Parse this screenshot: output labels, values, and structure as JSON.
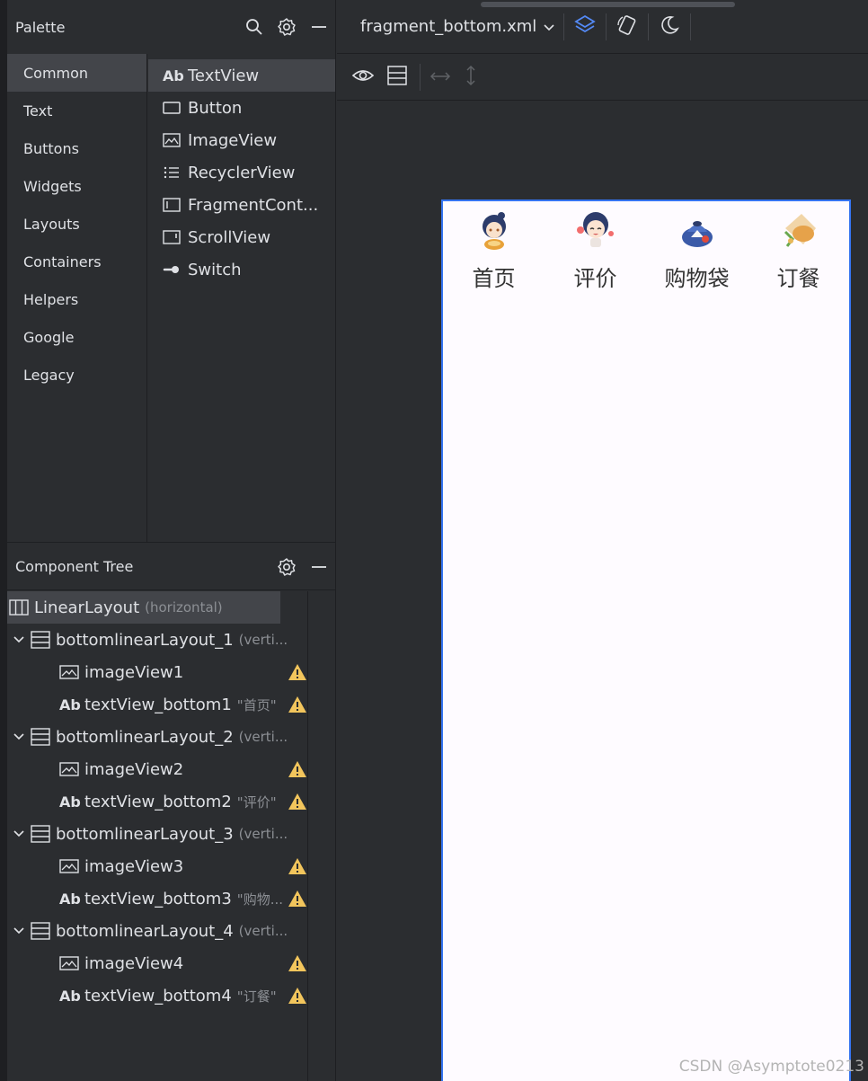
{
  "palette": {
    "title": "Palette",
    "categories": [
      "Common",
      "Text",
      "Buttons",
      "Widgets",
      "Layouts",
      "Containers",
      "Helpers",
      "Google",
      "Legacy"
    ],
    "widgets": [
      {
        "label": "TextView",
        "icon": "text-ab-icon"
      },
      {
        "label": "Button",
        "icon": "button-rect-icon"
      },
      {
        "label": "ImageView",
        "icon": "image-icon"
      },
      {
        "label": "RecyclerView",
        "icon": "list-icon"
      },
      {
        "label": "FragmentCont...",
        "icon": "fragment-icon"
      },
      {
        "label": "ScrollView",
        "icon": "scrollview-icon"
      },
      {
        "label": "Switch",
        "icon": "switch-icon"
      }
    ]
  },
  "tree": {
    "title": "Component Tree",
    "root": {
      "label": "LinearLayout",
      "sub": "(horizontal)"
    },
    "groups": [
      {
        "layout": "bottomlinearLayout_1",
        "sub": "(verti...",
        "image": "imageView1",
        "text": "textView_bottom1",
        "text_sub": "\"首页\""
      },
      {
        "layout": "bottomlinearLayout_2",
        "sub": "(verti...",
        "image": "imageView2",
        "text": "textView_bottom2",
        "text_sub": "\"评价\""
      },
      {
        "layout": "bottomlinearLayout_3",
        "sub": "(verti...",
        "image": "imageView3",
        "text": "textView_bottom3",
        "text_sub": "\"购物..."
      },
      {
        "layout": "bottomlinearLayout_4",
        "sub": "(verti...",
        "image": "imageView4",
        "text": "textView_bottom4",
        "text_sub": "\"订餐\""
      }
    ]
  },
  "editor": {
    "file": "fragment_bottom.xml",
    "tabs": [
      "首页",
      "评价",
      "购物袋",
      "订餐"
    ]
  },
  "watermark": "CSDN @Asymptote0213",
  "colors": {
    "accent": "#3574f0",
    "warning": "#f2c55c",
    "background": "#2b2d30",
    "selected": "#43454a"
  }
}
